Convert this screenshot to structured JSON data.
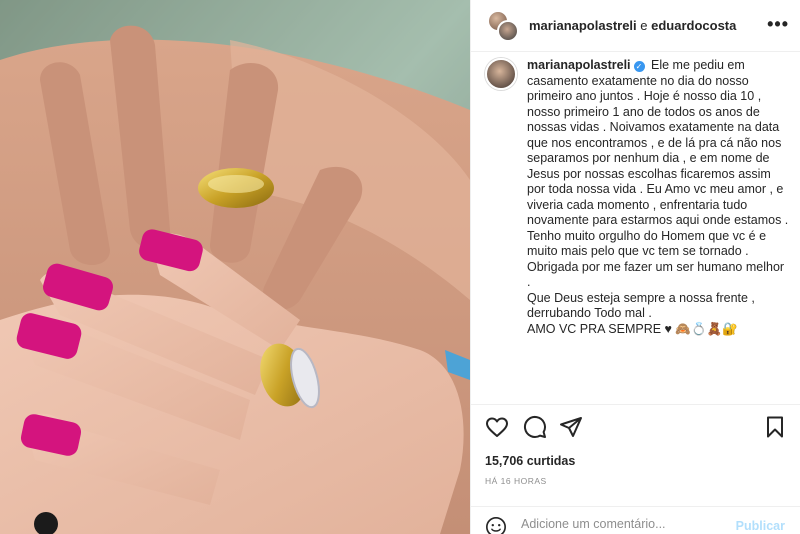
{
  "header": {
    "user1": "marianapolastreli",
    "sep": " e ",
    "user2": "eduardocosta",
    "more": "•••"
  },
  "caption": {
    "username": "marianapolastreli",
    "text": "Ele me pediu em casamento exatamente no dia do nosso primeiro ano juntos . Hoje é nosso dia 10 , nosso primeiro 1 ano de todos os anos de nossas vidas . Noivamos exatamente na data que nos encontramos , e de lá pra cá não nos separamos por nenhum dia , e em nome de Jesus por nossas escolhas ficaremos assim por toda nossa vida . Eu Amo vc meu amor , e viveria cada momento , enfrentaria tudo novamente para estarmos aqui onde estamos .",
    "p2": "Tenho muito orgulho do Homem que vc é e muito mais pelo que vc tem se tornado . Obrigada por me fazer um ser humano melhor .",
    "p3": "Que Deus esteja sempre a nossa frente , derrubando Todo mal .",
    "p4": "AMO VC PRA SEMPRE ♥ 🙈💍🧸🔐"
  },
  "stats": {
    "likes": "15,706 curtidas",
    "time": "HÁ 16 HORAS"
  },
  "comment": {
    "placeholder": "Adicione um comentário...",
    "publish": "Publicar"
  },
  "icons": {
    "like": "heart-icon",
    "comment": "comment-icon",
    "share": "share-icon",
    "save": "bookmark-icon",
    "emoji": "emoji-icon",
    "verified": "verified-badge-icon"
  },
  "colors": {
    "nail": "#d4147e",
    "ring": "#c9a227",
    "verified": "#3897f0",
    "publish": "#b2dffc"
  }
}
